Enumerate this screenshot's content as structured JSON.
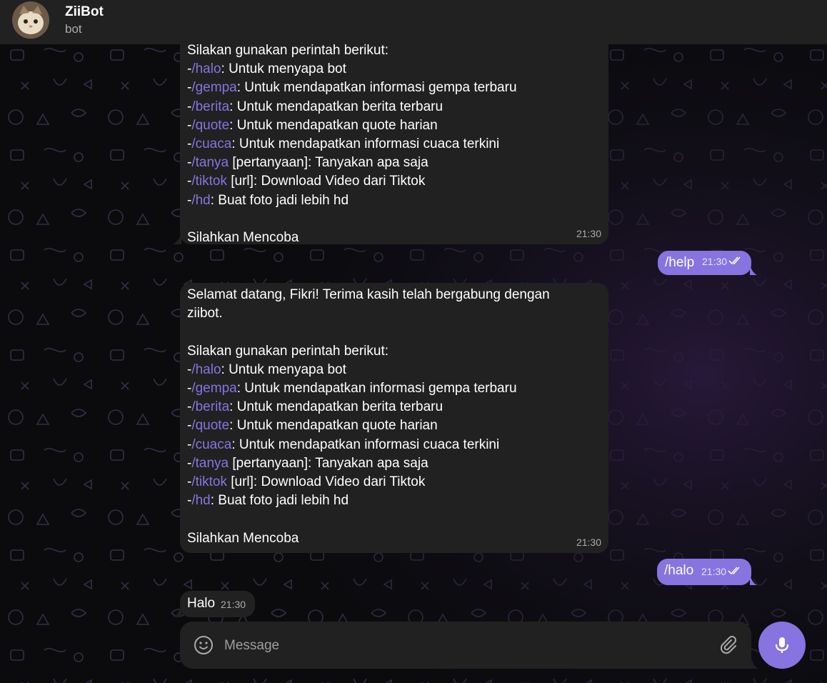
{
  "header": {
    "title": "ZiiBot",
    "status": "bot"
  },
  "messages": [
    {
      "id": "m1",
      "direction": "incoming",
      "lines": [
        {
          "text": "Silakan gunakan perintah berikut:"
        },
        {
          "prefix": "-",
          "cmd": "/halo",
          "text": ": Untuk menyapa bot"
        },
        {
          "prefix": "-",
          "cmd": "/gempa",
          "text": ": Untuk mendapatkan informasi gempa terbaru"
        },
        {
          "prefix": "-",
          "cmd": "/berita",
          "text": ": Untuk mendapatkan berita terbaru"
        },
        {
          "prefix": "-",
          "cmd": "/quote",
          "text": ": Untuk mendapatkan quote harian"
        },
        {
          "prefix": "-",
          "cmd": "/cuaca",
          "text": ": Untuk mendapatkan informasi cuaca terkini"
        },
        {
          "prefix": "-",
          "cmd": "/tanya",
          "text": " [pertanyaan]: Tanyakan apa saja"
        },
        {
          "prefix": "-",
          "cmd": "/tiktok",
          "text": " [url]: Download Video dari Tiktok"
        },
        {
          "prefix": "-",
          "cmd": "/hd",
          "text": ": Buat foto jadi lebih hd"
        },
        {
          "text": ""
        },
        {
          "text": "Silahkan Mencoba"
        }
      ],
      "time": "21:30"
    },
    {
      "id": "m3",
      "direction": "outgoing",
      "text": "/help",
      "time": "21:30"
    },
    {
      "id": "m2",
      "direction": "incoming",
      "lines": [
        {
          "text": "Selamat datang, Fikri! Terima kasih telah bergabung dengan"
        },
        {
          "text": "ziibot."
        },
        {
          "text": ""
        },
        {
          "text": "Silakan gunakan perintah berikut:"
        },
        {
          "prefix": "-",
          "cmd": "/halo",
          "text": ": Untuk menyapa bot"
        },
        {
          "prefix": "-",
          "cmd": "/gempa",
          "text": ": Untuk mendapatkan informasi gempa terbaru"
        },
        {
          "prefix": "-",
          "cmd": "/berita",
          "text": ": Untuk mendapatkan berita terbaru"
        },
        {
          "prefix": "-",
          "cmd": "/quote",
          "text": ": Untuk mendapatkan quote harian"
        },
        {
          "prefix": "-",
          "cmd": "/cuaca",
          "text": ": Untuk mendapatkan informasi cuaca terkini"
        },
        {
          "prefix": "-",
          "cmd": "/tanya",
          "text": " [pertanyaan]: Tanyakan apa saja"
        },
        {
          "prefix": "-",
          "cmd": "/tiktok",
          "text": " [url]: Download Video dari Tiktok"
        },
        {
          "prefix": "-",
          "cmd": "/hd",
          "text": ": Buat foto jadi lebih hd"
        },
        {
          "text": ""
        },
        {
          "text": "Silahkan Mencoba"
        }
      ],
      "time": "21:30"
    },
    {
      "id": "m4",
      "direction": "outgoing",
      "text": "/halo",
      "time": "21:30"
    },
    {
      "id": "m5",
      "direction": "incoming",
      "text": "Halo",
      "time": "21:30"
    }
  ],
  "composer": {
    "placeholder": "Message"
  },
  "icons": {
    "emoji": "smile-icon",
    "attach": "paperclip-icon",
    "mic": "microphone-icon",
    "read": "double-check-icon"
  },
  "colors": {
    "accent": "#8774e1",
    "bubble_in": "#212121",
    "header": "#212121",
    "background": "#0b0b0e"
  }
}
